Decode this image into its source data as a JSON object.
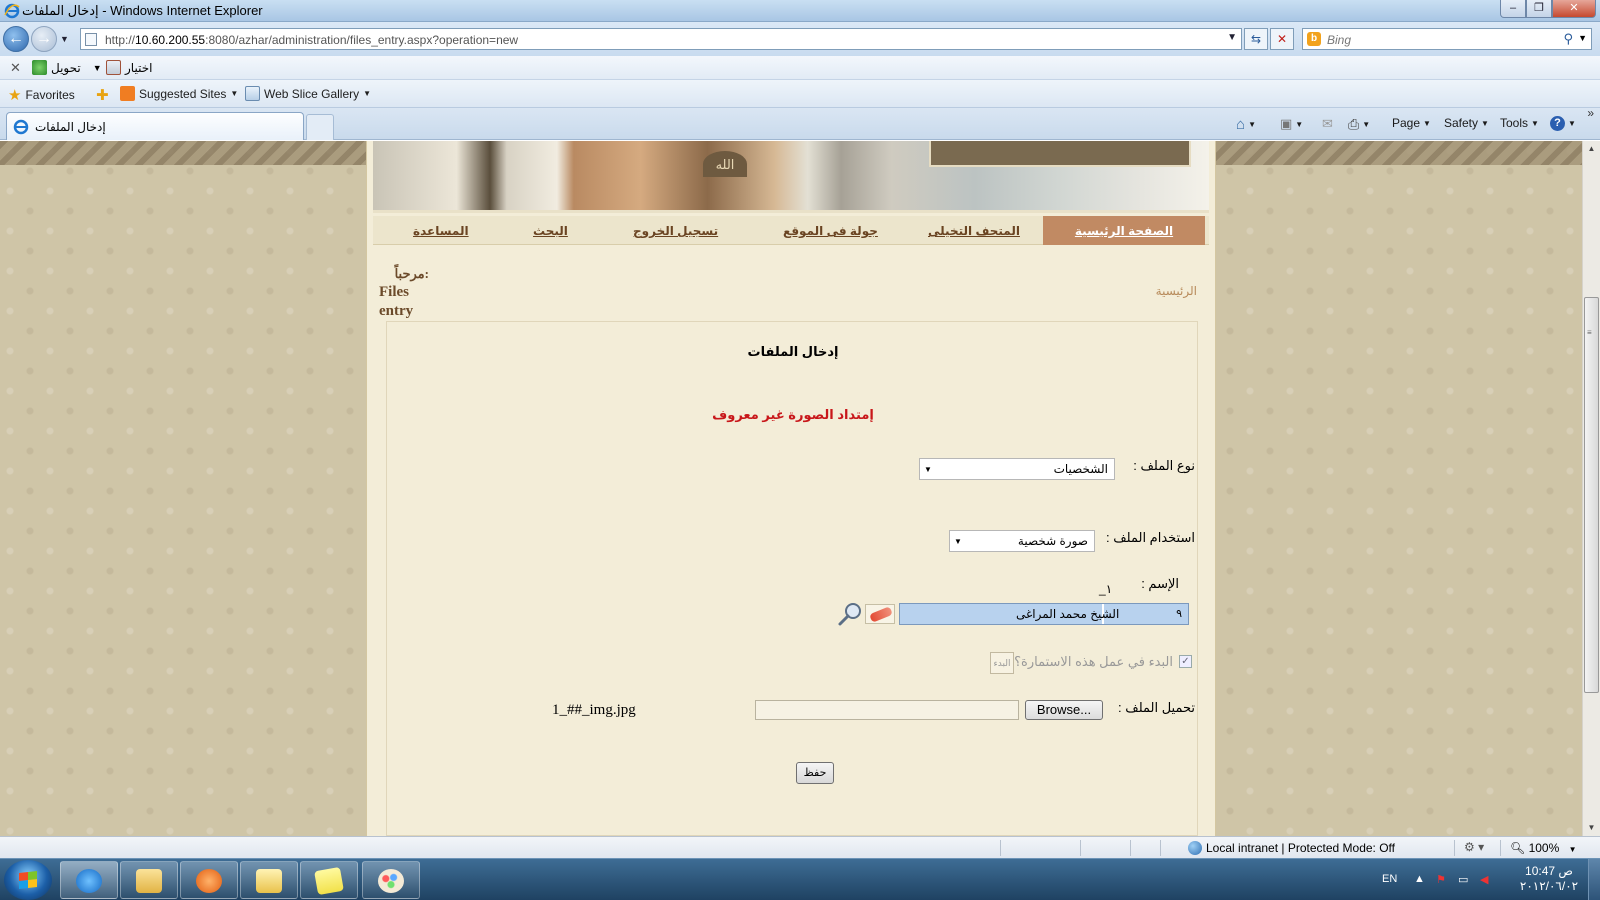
{
  "window": {
    "title": "إدخال الملفات - Windows Internet Explorer",
    "min_label": "‒",
    "max_label": "❐",
    "close_label": "✕"
  },
  "address": {
    "url_prefix": "http://",
    "url_host": "10.60.200.55",
    "url_path": ":8080/azhar/administration/files_entry.aspx?operation=new",
    "search_placeholder": "Bing"
  },
  "custom_toolbar": {
    "convert_label": "تحويل",
    "select_label": "اختيار"
  },
  "favorites_bar": {
    "favorites_label": "Favorites",
    "suggested_label": "Suggested Sites",
    "webslice_label": "Web Slice Gallery"
  },
  "tab": {
    "title": "إدخال الملفات"
  },
  "command_bar": {
    "page_label": "Page",
    "safety_label": "Safety",
    "tools_label": "Tools"
  },
  "site": {
    "seal_text": "الله",
    "menu": [
      {
        "label": "الصفحة الرئيسية"
      },
      {
        "label": "المتحف التخيلى"
      },
      {
        "label": "جولة فى الموقع"
      },
      {
        "label": "تسجيل الخروج"
      },
      {
        "label": "البحث"
      },
      {
        "label": "المساعدة"
      }
    ],
    "welcome_prefix": "مرحباً:",
    "welcome_name": "Files entry",
    "breadcrumb": "الرئيسية"
  },
  "form": {
    "title": "إدخال الملفات",
    "error": "إمتداد الصورة غير معروف",
    "file_type_label": "نوع الملف :",
    "file_type_value": "الشخصيات",
    "file_usage_label": "استخدام الملف :",
    "file_usage_value": "صورة شخصية",
    "name_label": "الإسم :",
    "name_code": "١_",
    "name_id": "٩",
    "name_value": "الشيخ محمد المراغى",
    "start_question": "البدء في عمل هذه الاستمارة؟",
    "start_button": "البدء",
    "upload_label": "تحميل الملف :",
    "browse_button": "Browse...",
    "selected_file": "1_##_img.jpg",
    "save_button": "حفظ"
  },
  "status_bar": {
    "zone": "Local intranet | Protected Mode: Off",
    "zoom": "100%"
  },
  "taskbar": {
    "language": "EN",
    "time": "10:47 ص",
    "date": "٢٠١٢/٠٦/٠٢"
  }
}
